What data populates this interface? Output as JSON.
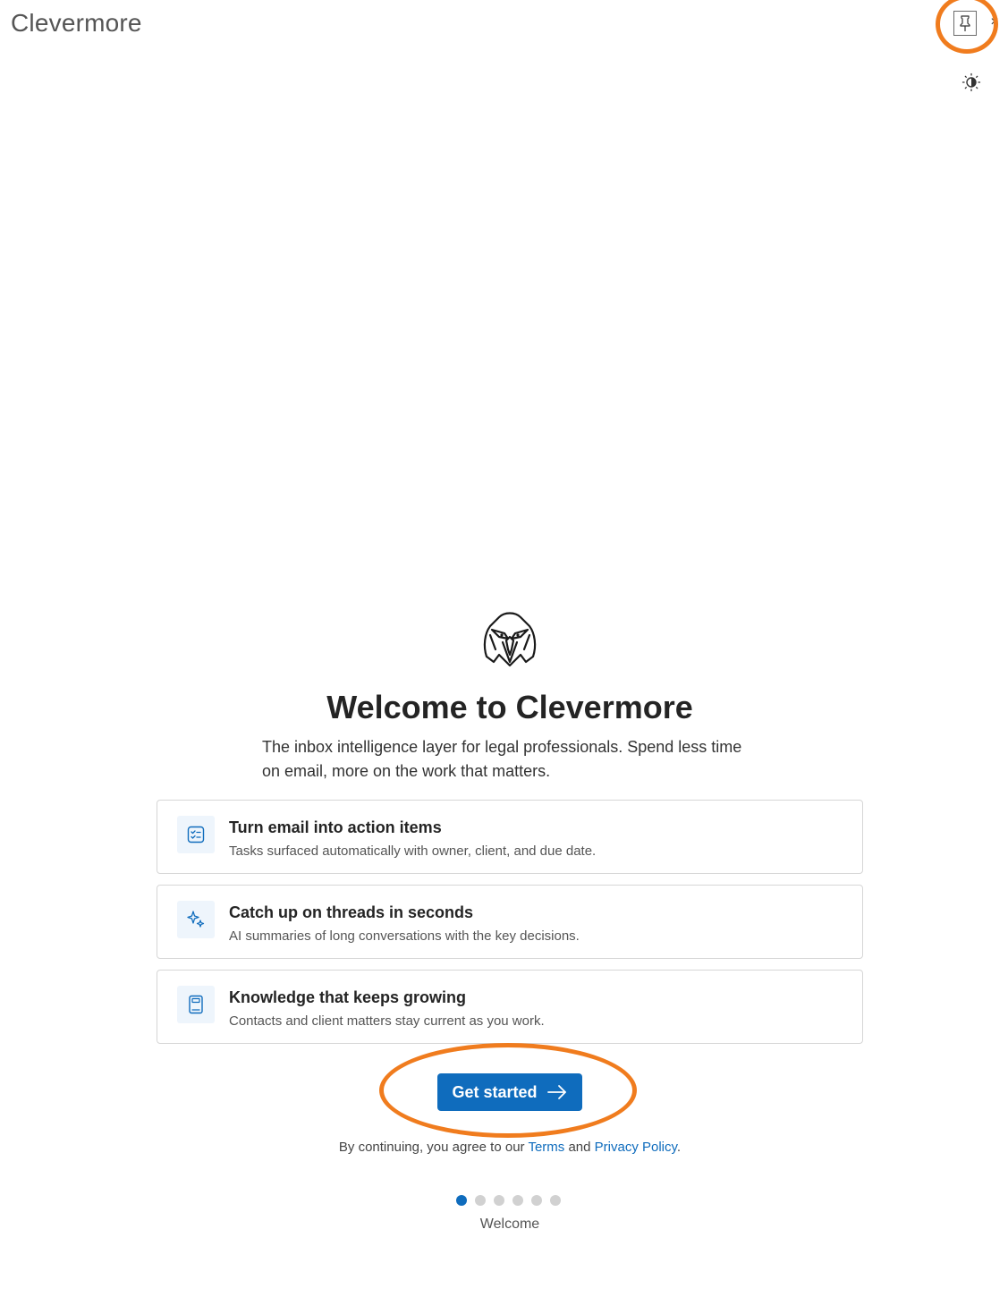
{
  "header": {
    "app_title": "Clevermore",
    "pin_icon": "pin-icon",
    "close_label": "×",
    "theme_icon": "theme-toggle-icon"
  },
  "hero": {
    "logo_icon": "eagle-logo-icon",
    "title": "Welcome to Clevermore",
    "subtitle": "The inbox intelligence layer for legal professionals. Spend less time on email, more on the work that matters."
  },
  "features": [
    {
      "icon": "task-list-icon",
      "title": "Turn email into action items",
      "description": "Tasks surfaced automatically with owner, client, and due date."
    },
    {
      "icon": "sparkle-icon",
      "title": "Catch up on threads in seconds",
      "description": "AI summaries of long conversations with the key decisions."
    },
    {
      "icon": "notebook-icon",
      "title": "Knowledge that keeps growing",
      "description": "Contacts and client matters stay current as you work."
    }
  ],
  "cta": {
    "label": "Get started",
    "icon": "arrow-right-icon"
  },
  "legal": {
    "prefix": "By continuing, you agree to our ",
    "terms_label": "Terms",
    "middle": " and ",
    "privacy_label": "Privacy Policy",
    "suffix": "."
  },
  "stepper": {
    "total_steps": 6,
    "current_step": 1,
    "current_label": "Welcome"
  },
  "colors": {
    "accent": "#0f6cbd",
    "annotation": "#f07c1e",
    "icon_bg": "#eef5fc"
  }
}
